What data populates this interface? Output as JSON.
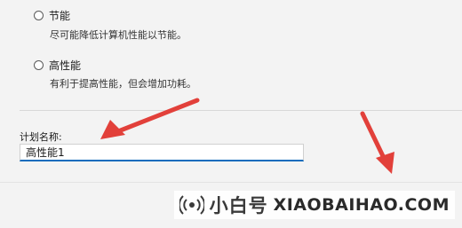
{
  "power_plan": {
    "options": [
      {
        "title": "节能",
        "description": "尽可能降低计算机性能以节能。"
      },
      {
        "title": "高性能",
        "description": "有利于提高性能，但会增加功耗。"
      }
    ],
    "plan_name_label": "计划名称:",
    "plan_name_value": "高性能1"
  },
  "watermark": {
    "brand_cn": "小白号",
    "brand_en": "XIAOBAIHAO.COM",
    "icon": "broadcast-icon"
  },
  "colors": {
    "arrow": "#e2403a",
    "input_focus": "#0f6cbd"
  }
}
